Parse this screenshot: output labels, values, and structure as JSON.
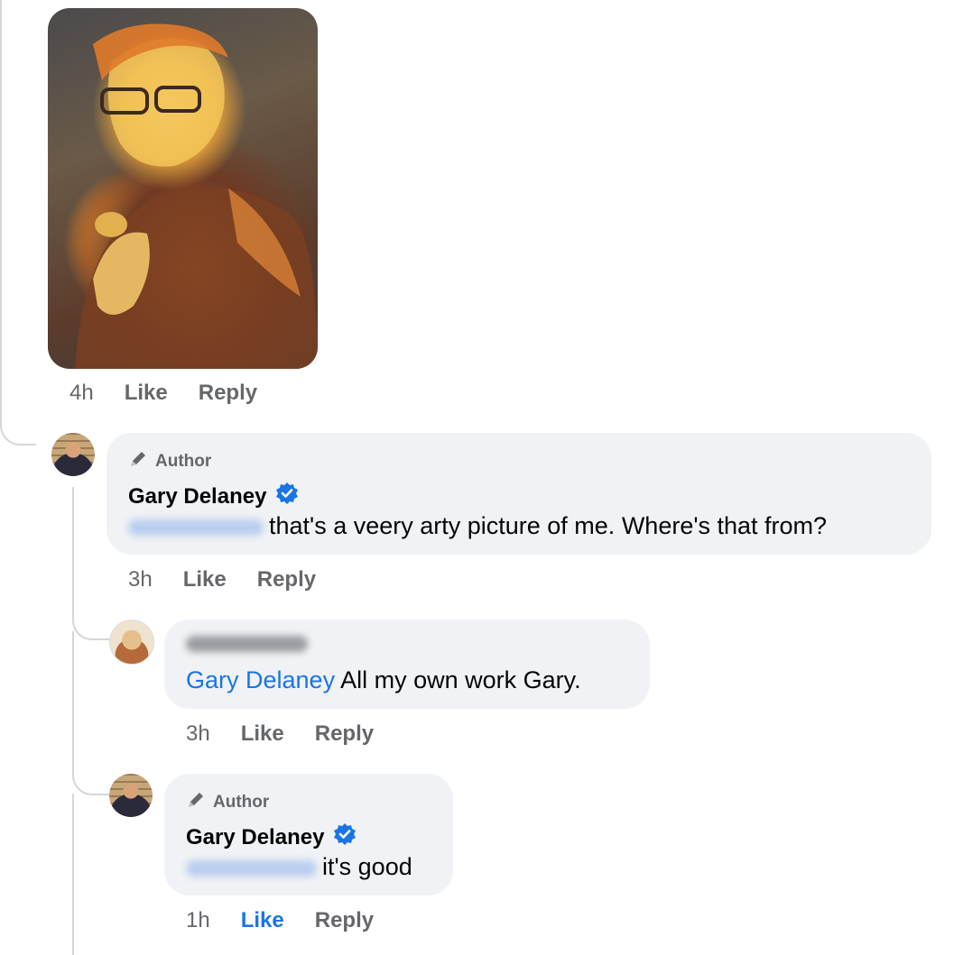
{
  "first_comment": {
    "time": "4h",
    "like_label": "Like",
    "reply_label": "Reply"
  },
  "reply1": {
    "badge": "Author",
    "name": "Gary Delaney",
    "verified_icon": "verified-badge-icon",
    "mention": "Steve Mills",
    "text": "that's a veery arty picture of me. Where's that from?",
    "time": "3h",
    "like_label": "Like",
    "reply_label": "Reply"
  },
  "reply2": {
    "name": "Steve Mills",
    "mention": "Gary Delaney",
    "text": " All my own work Gary.",
    "time": "3h",
    "like_label": "Like",
    "reply_label": "Reply"
  },
  "reply3": {
    "badge": "Author",
    "name": "Gary Delaney",
    "mention": "Steve Mills",
    "text": "it's good",
    "time": "1h",
    "like_label": "Like",
    "reply_label": "Reply",
    "like_active": true
  },
  "colors": {
    "link_blue": "#1b74e4",
    "bubble_bg": "#f0f2f5",
    "meta_gray": "#65676b"
  }
}
